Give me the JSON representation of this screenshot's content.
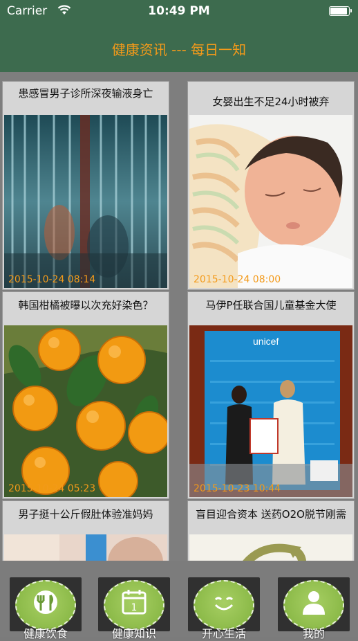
{
  "status_bar": {
    "carrier": "Carrier",
    "time": "10:49 PM"
  },
  "header": {
    "title": "健康资讯 --- 每日一知"
  },
  "articles": [
    {
      "headline": "患感冒男子诊所深夜输液身亡",
      "date": "2015-10-24 08:14",
      "image": "iv-drip-photo"
    },
    {
      "headline": "女婴出生不足24小时被弃",
      "date": "2015-10-24 08:00",
      "image": "newborn-baby-photo"
    },
    {
      "headline": "韩国柑橘被曝以次充好染色？",
      "date": "2015-10-24 05:23",
      "image": "oranges-photo"
    },
    {
      "headline": "马伊P任联合国儿童基金大使",
      "date": "2015-10-23 10:44",
      "image": "unicef-ceremony-photo"
    },
    {
      "headline": "男子挺十公斤假肚体验准妈妈",
      "date": "",
      "image": "belly-photo"
    },
    {
      "headline": "盲目迎合资本  送药O2O脱节刚需",
      "date": "",
      "image": "o2o-graphic"
    }
  ],
  "tabs": [
    {
      "label": "健康饮食",
      "icon": "fork-knife-icon"
    },
    {
      "label": "健康知识",
      "icon": "calendar-icon"
    },
    {
      "label": "开心生活",
      "icon": "smile-icon"
    },
    {
      "label": "我的",
      "icon": "person-icon"
    }
  ],
  "colors": {
    "header_bg": "#3d6b4e",
    "accent_orange": "#f39a1a",
    "tab_green": "#8dbb4a"
  }
}
